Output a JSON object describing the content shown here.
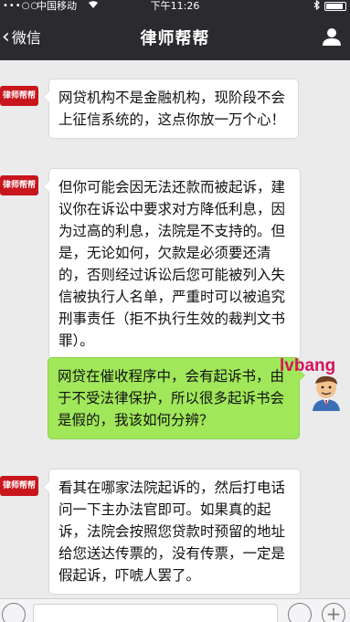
{
  "status_bar": {
    "signal_dots": "•••○○",
    "carrier": "中国移动",
    "wifi_icon": "wifi-icon",
    "time": "下午11:26",
    "bluetooth_icon": "bluetooth-icon",
    "battery_level": 0.9
  },
  "nav": {
    "back_label": "微信",
    "title": "律师帮帮",
    "profile_icon": "person-icon"
  },
  "messages": [
    {
      "sender": "lawyer",
      "avatar_text": "律师帮帮",
      "text": "网贷机构不是金融机构，现阶段不会上征信系统的，这点你放一万个心！"
    },
    {
      "sender": "lawyer",
      "avatar_text": "律师帮帮",
      "text": "但你可能会因无法还款而被起诉，建议你在诉讼中要求对方降低利息，因为过高的利息，法院是不支持的。但是，无论如何，欠款是必须要还清的，否则经过诉讼后您可能被列入失信被执行人名单，严重时可以被追究刑事责任（拒不执行生效的裁判文书罪）。"
    },
    {
      "sender": "user",
      "text": "网贷在催收程序中，会有起诉书，由于不受法律保护，所以很多起诉书会是假的，我该如何分辨？"
    },
    {
      "sender": "lawyer",
      "avatar_text": "律师帮帮",
      "text": "看其在哪家法院起诉的，然后打电话问一下主办法官即可。如果真的起诉，法院会按照您贷款时预留的地址给您送达传票的，没有传票，一定是假起诉，吓唬人罢了。"
    }
  ],
  "watermark": "lvbang",
  "colors": {
    "header_bg": "#2b2b2f",
    "chat_bg": "#ebebeb",
    "user_bubble": "#a0e75a",
    "lawyer_avatar": "#c8161d",
    "watermark": "#d4145a"
  },
  "input_bar": {
    "voice_icon": "voice-icon",
    "emoji_icon": "emoji-icon",
    "plus_icon": "plus-icon",
    "plus_glyph": "+"
  }
}
